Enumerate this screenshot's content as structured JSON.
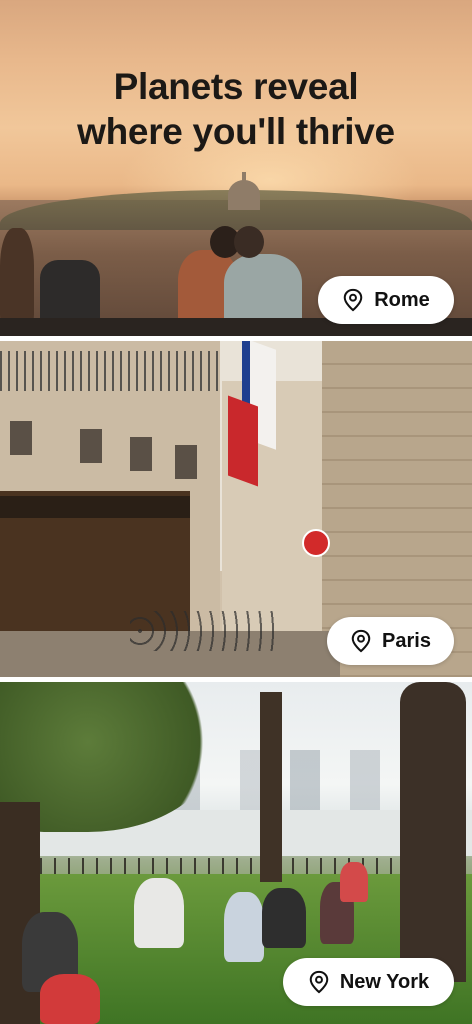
{
  "headline": {
    "line1": "Planets reveal",
    "line2": "where you'll thrive"
  },
  "cities": [
    {
      "name": "Rome",
      "icon": "location-pin-icon"
    },
    {
      "name": "Paris",
      "icon": "location-pin-icon"
    },
    {
      "name": "New York",
      "icon": "location-pin-icon"
    }
  ],
  "colors": {
    "headline_text": "#1c1916",
    "chip_background": "#ffffff",
    "chip_text": "#111111"
  }
}
